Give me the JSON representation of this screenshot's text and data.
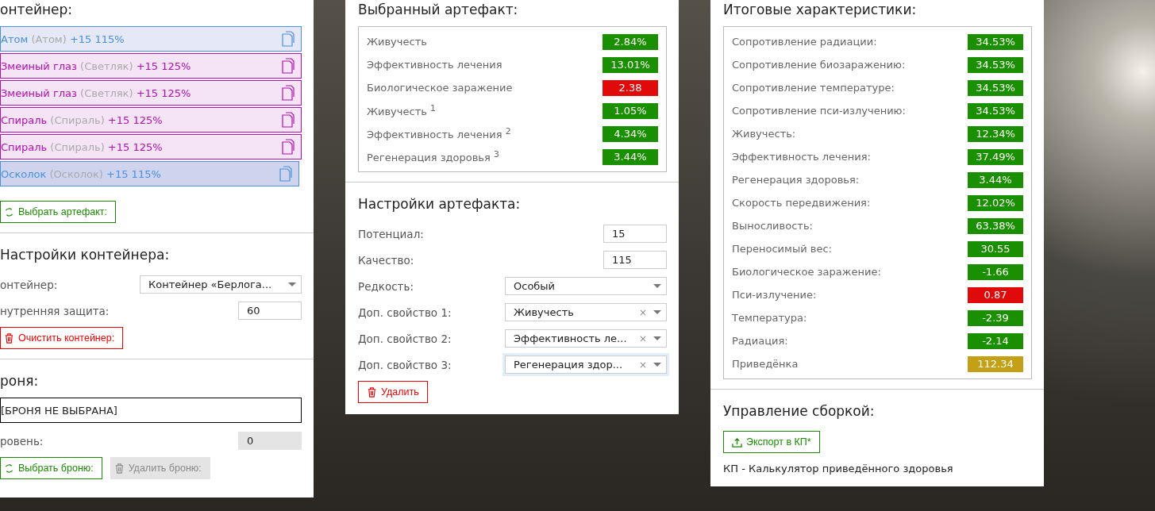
{
  "container": {
    "title": "онтейнер:",
    "items": [
      {
        "name": "Атом",
        "alias": "(Атом)",
        "bonus": "+15 115%",
        "color": "#4a8fe0",
        "selected": false
      },
      {
        "name": "Змеиный глаз",
        "alias": "(Светляк)",
        "bonus": "+15 125%",
        "color": "#b010b0",
        "selected": false
      },
      {
        "name": "Змеиный глаз",
        "alias": "(Светляк)",
        "bonus": "+15 125%",
        "color": "#b010b0",
        "selected": false
      },
      {
        "name": "Спираль",
        "alias": "(Спираль)",
        "bonus": "+15 125%",
        "color": "#b010b0",
        "selected": false
      },
      {
        "name": "Спираль",
        "alias": "(Спираль)",
        "bonus": "+15 125%",
        "color": "#b010b0",
        "selected": false
      },
      {
        "name": "Осколок",
        "alias": "(Осколок)",
        "bonus": "+15 115%",
        "color": "#4a8fe0",
        "selected": true
      }
    ],
    "button": {
      "label": "Выбрать артефакт:",
      "kind": "select"
    }
  },
  "container_settings": {
    "title": "Настройки контейнера:",
    "fields": [
      {
        "kind": "select",
        "label": "онтейнер:",
        "value": "Контейнер «Берлога...",
        "focused": false
      },
      {
        "kind": "input",
        "label": "нутренняя защита:",
        "value": "60",
        "disabled": false
      }
    ],
    "button": {
      "label": "Очистить контейнер:",
      "kind": "danger"
    }
  },
  "armor": {
    "title": "роня:",
    "name": "[БРОНЯ НЕ ВЫБРАНА]",
    "fields": [
      {
        "label": "ровень:",
        "value": "0",
        "disabled": true
      }
    ],
    "buttons": [
      {
        "label": "Выбрать броню:",
        "kind": "select"
      },
      {
        "label": "Удалить броню:",
        "kind": "disabled"
      }
    ]
  },
  "selected_artifact": {
    "title": "Выбранный артефакт:",
    "stats": [
      {
        "label": "Живучесть",
        "value": "2.84%",
        "color": "#1a9000"
      },
      {
        "label": "Эффективность лечения",
        "value": "13.01%",
        "color": "#1a9000"
      },
      {
        "label": "Биологическое заражение",
        "value": "2.38",
        "color": "#e00a0a"
      },
      {
        "label": "Живучесть $^{1}$",
        "value": "1.05%",
        "color": "#1a9000"
      },
      {
        "label": "Эффективность лечения $^{2}$",
        "value": "4.34%",
        "color": "#1a9000"
      },
      {
        "label": "Регенерация здоровья $^{3}$",
        "value": "3.44%",
        "color": "#1a9000"
      }
    ]
  },
  "artifact_settings": {
    "title": "Настройки артефакта:",
    "fields": [
      {
        "kind": "input",
        "label": "Потенциал:",
        "value": "15",
        "disabled": false
      },
      {
        "kind": "input",
        "label": "Качество:",
        "value": "115",
        "disabled": false
      },
      {
        "kind": "select",
        "label": "Редкость:",
        "value": "Особый",
        "focused": false
      },
      {
        "kind": "select",
        "label": "Доп. свойство 1:",
        "value": "Живучесть",
        "clear": "×",
        "focused": false
      },
      {
        "kind": "select",
        "label": "Доп. свойство 2:",
        "value": "Эффективность ле...",
        "clear": "×",
        "focused": false
      },
      {
        "kind": "select",
        "label": "Доп. свойство 3:",
        "value": "Регенерация здор...",
        "clear": "×",
        "focused": true
      }
    ],
    "button": {
      "label": "Удалить",
      "kind": "danger"
    }
  },
  "totals": {
    "title": "Итоговые характеристики:",
    "stats": [
      {
        "label": "Сопротивление радиации:",
        "value": "34.53%",
        "color": "#1a9000"
      },
      {
        "label": "Сопротивление биозаражению:",
        "value": "34.53%",
        "color": "#1a9000"
      },
      {
        "label": "Сопротивление температуре:",
        "value": "34.53%",
        "color": "#1a9000"
      },
      {
        "label": "Сопротивление пси-излучению:",
        "value": "34.53%",
        "color": "#1a9000"
      },
      {
        "label": "Живучесть:",
        "value": "12.34%",
        "color": "#1a9000"
      },
      {
        "label": "Эффективность лечения:",
        "value": "37.49%",
        "color": "#1a9000"
      },
      {
        "label": "Регенерация здоровья:",
        "value": "3.44%",
        "color": "#1a9000"
      },
      {
        "label": "Скорость передвижения:",
        "value": "12.02%",
        "color": "#1a9000"
      },
      {
        "label": "Выносливость:",
        "value": "63.38%",
        "color": "#1a9000"
      },
      {
        "label": "Переносимый вес:",
        "value": "30.55",
        "color": "#1a9000"
      },
      {
        "label": "Биологическое заражение:",
        "value": "-1.66",
        "color": "#1a9000"
      },
      {
        "label": "Пси-излучение:",
        "value": "0.87",
        "color": "#e00a0a"
      },
      {
        "label": "Температура:",
        "value": "-2.39",
        "color": "#1a9000"
      },
      {
        "label": "Радиация:",
        "value": "-2.14",
        "color": "#1a9000"
      },
      {
        "label": "Приведёнка",
        "value": "112.34",
        "color": "#c4a016"
      }
    ]
  },
  "build": {
    "title": "Управление сборкой:",
    "button": {
      "label": "Экспорт в КП*",
      "kind": "export"
    },
    "note": "КП - Калькулятор приведённого здоровья"
  }
}
